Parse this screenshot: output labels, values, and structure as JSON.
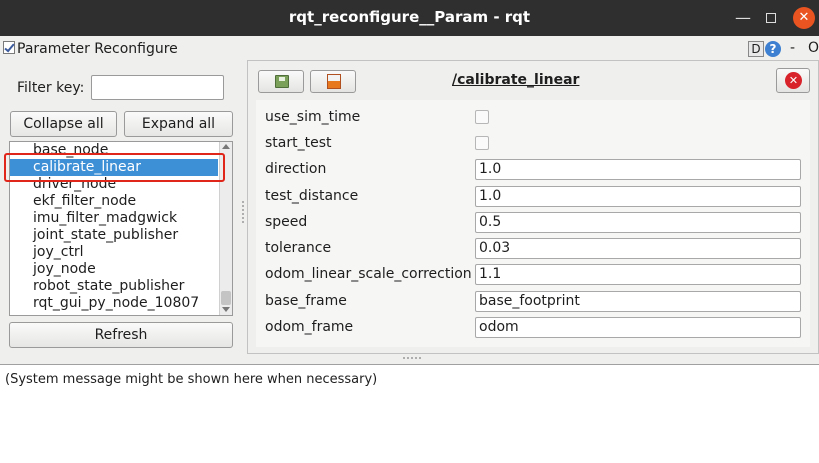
{
  "window": {
    "title": "rqt_reconfigure__Param - rqt",
    "minimize_icon": "minimize-icon",
    "maximize_icon": "maximize-icon",
    "close_glyph": "✕"
  },
  "plugin": {
    "title": "Parameter Reconfigure",
    "d_label": "D",
    "help_label": "?",
    "dash_label": "-",
    "o_label": "O"
  },
  "filter": {
    "label": "Filter key:",
    "value": ""
  },
  "buttons": {
    "collapse_all": "Collapse all",
    "expand_all": "Expand all",
    "refresh": "Refresh"
  },
  "node_list": {
    "items": [
      "base_node",
      "calibrate_linear",
      "driver_node",
      "ekf_filter_node",
      "imu_filter_madgwick",
      "joint_state_publisher",
      "joy_ctrl",
      "joy_node",
      "robot_state_publisher",
      "rqt_gui_py_node_10807"
    ],
    "selected": "calibrate_linear"
  },
  "editor": {
    "node_title": "/calibrate_linear",
    "save_icon": "save-icon",
    "load_icon": "load-icon",
    "close_glyph": "✕",
    "params": [
      {
        "name": "use_sim_time",
        "type": "bool",
        "value": ""
      },
      {
        "name": "start_test",
        "type": "bool",
        "value": ""
      },
      {
        "name": "direction",
        "type": "text",
        "value": "1.0"
      },
      {
        "name": "test_distance",
        "type": "text",
        "value": "1.0"
      },
      {
        "name": "speed",
        "type": "text",
        "value": "0.5"
      },
      {
        "name": "tolerance",
        "type": "text",
        "value": "0.03"
      },
      {
        "name": "odom_linear_scale_correction",
        "type": "text",
        "value": "1.1"
      },
      {
        "name": "base_frame",
        "type": "text",
        "value": "base_footprint"
      },
      {
        "name": "odom_frame",
        "type": "text",
        "value": "odom"
      }
    ]
  },
  "status": {
    "message": "(System message might be shown here when necessary)"
  },
  "colors": {
    "selection": "#3d8fd6",
    "highlight": "#e0251b",
    "titlebar": "#2f2f2f",
    "close_accent": "#e95420"
  }
}
